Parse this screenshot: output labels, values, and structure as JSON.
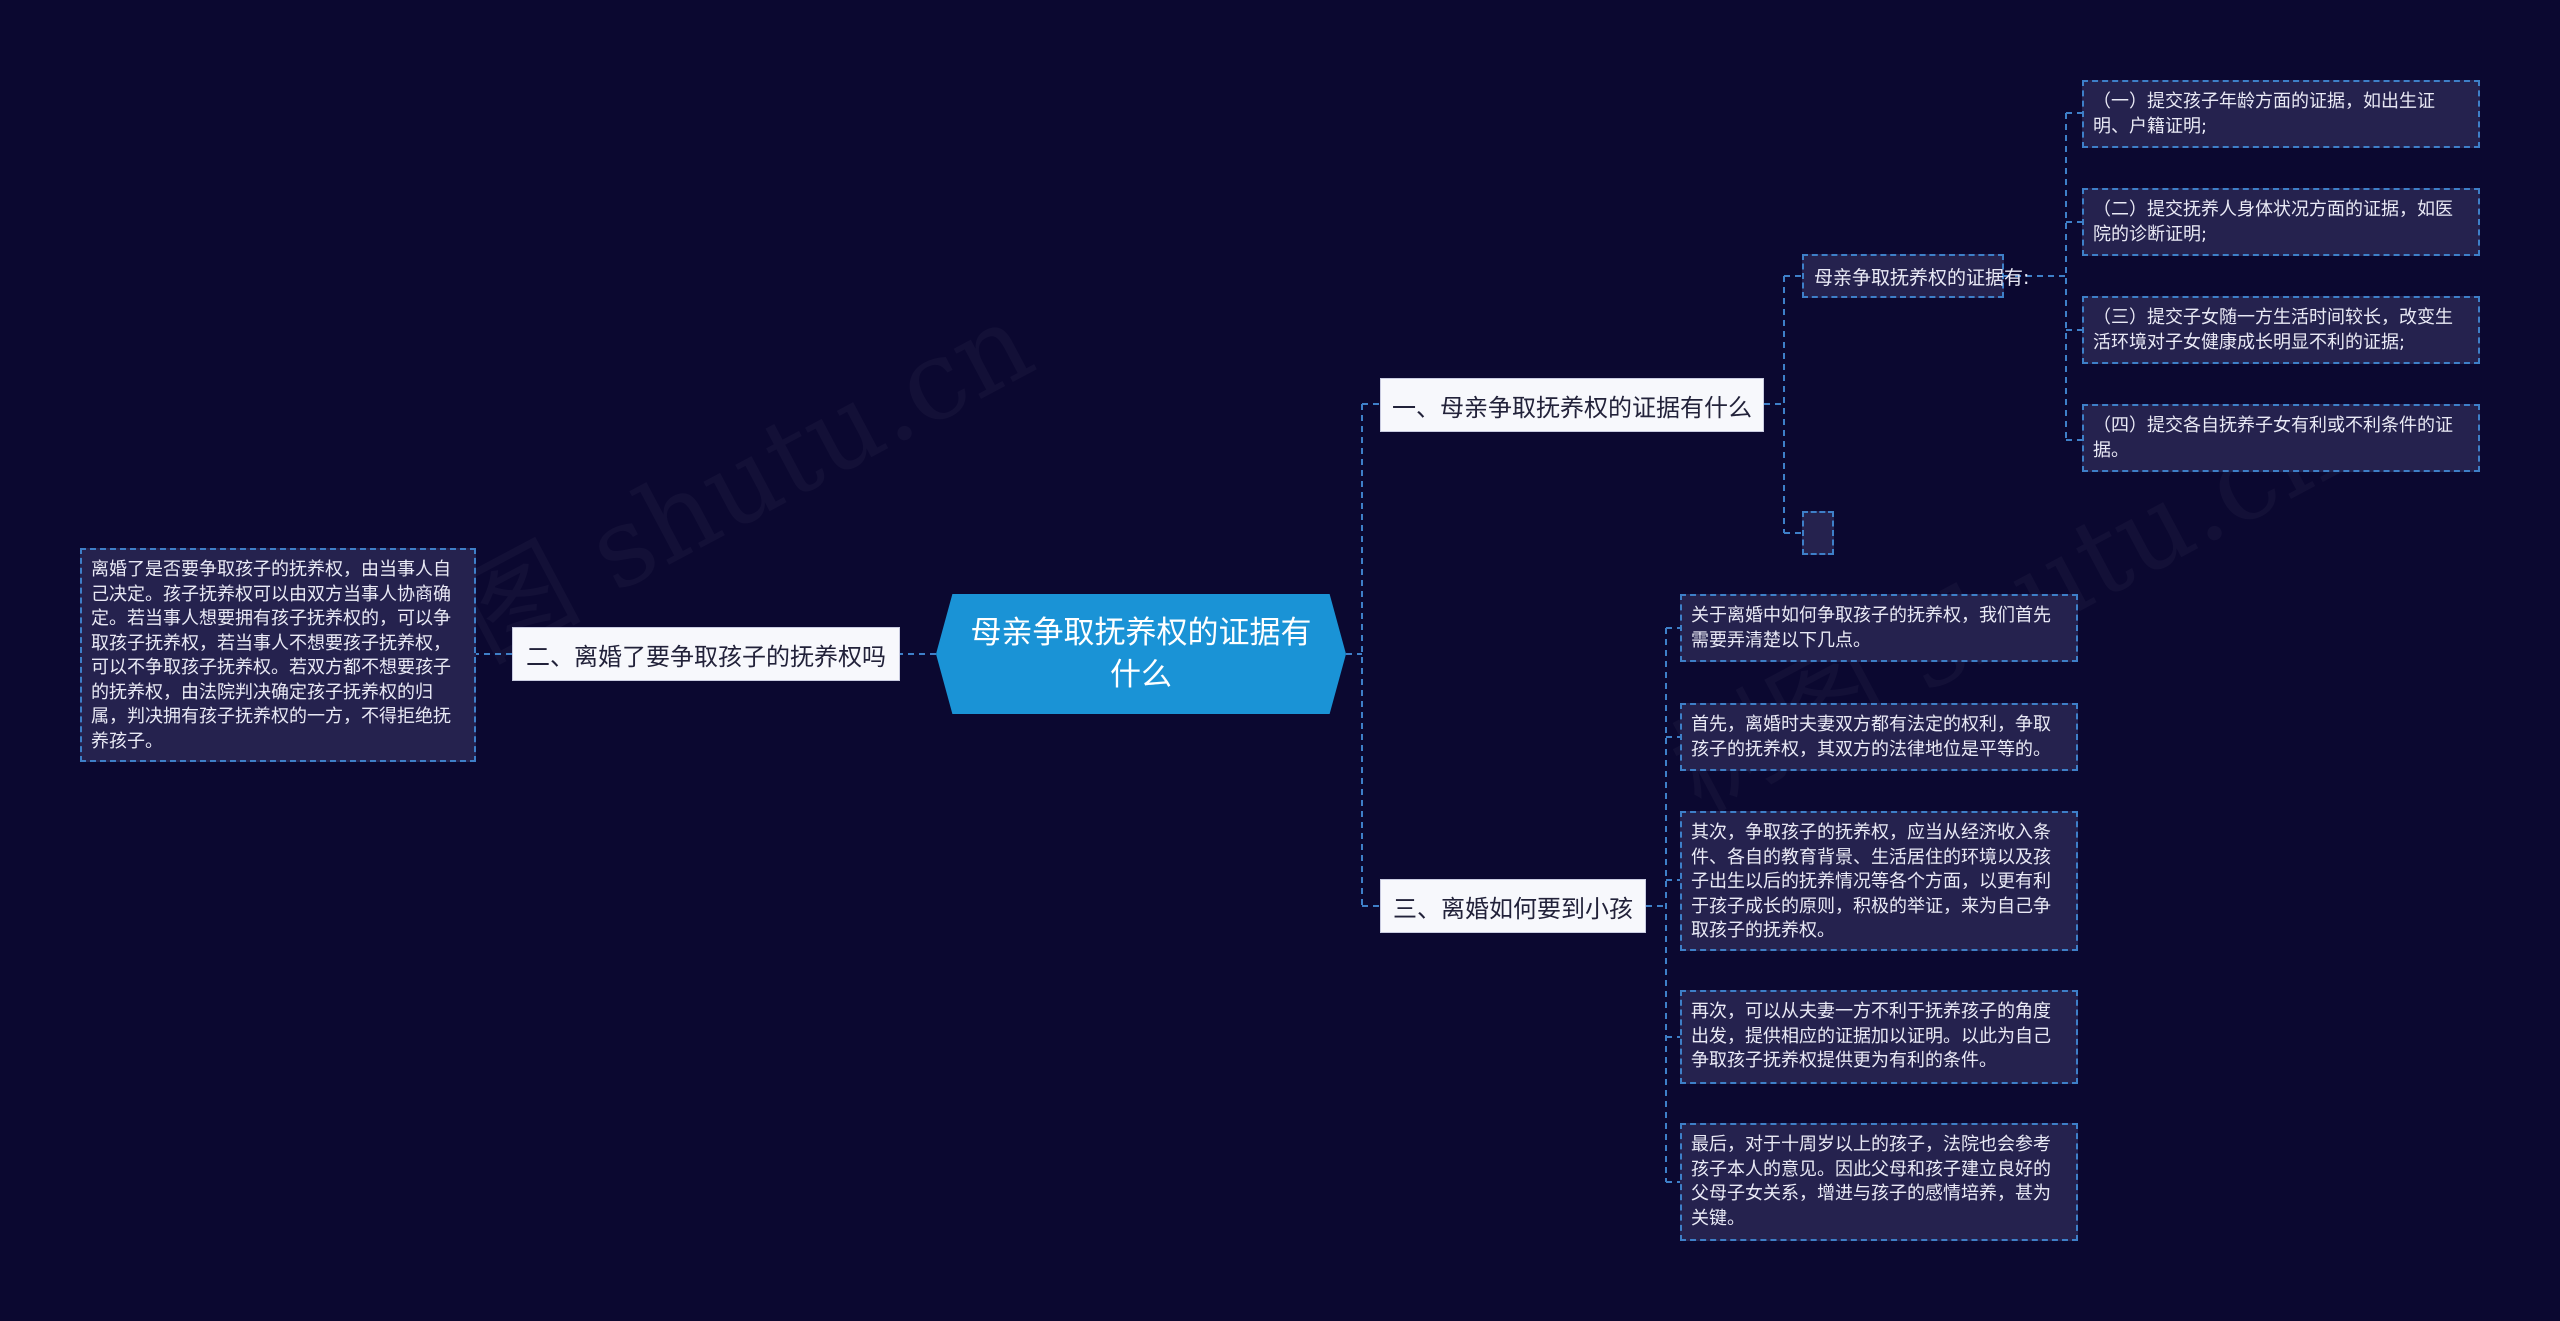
{
  "watermarks": [
    "树图 shutu.cn",
    "树图 shutu.cn"
  ],
  "root": {
    "text": "母亲争取抚养权的证据有什么"
  },
  "branches": {
    "b1": "一、母亲争取抚养权的证据有什么",
    "b2": "二、离婚了要争取孩子的抚养权吗",
    "b3": "三、离婚如何要到小孩"
  },
  "b1_label": "母亲争取抚养权的证据有:",
  "b1_items": [
    "（一）提交孩子年龄方面的证据，如出生证明、户籍证明;",
    "（二）提交抚养人身体状况方面的证据，如医院的诊断证明;",
    "（三）提交子女随一方生活时间较长，改变生活环境对子女健康成长明显不利的证据;",
    "（四）提交各自抚养子女有利或不利条件的证据。"
  ],
  "b2_detail": "离婚了是否要争取孩子的抚养权，由当事人自己决定。孩子抚养权可以由双方当事人协商确定。若当事人想要拥有孩子抚养权的，可以争取孩子抚养权，若当事人不想要孩子抚养权，可以不争取孩子抚养权。若双方都不想要孩子的抚养权，由法院判决确定孩子抚养权的归属，判决拥有孩子抚养权的一方，不得拒绝抚养孩子。",
  "b3_items": [
    "关于离婚中如何争取孩子的抚养权，我们首先需要弄清楚以下几点。",
    "首先，离婚时夫妻双方都有法定的权利，争取孩子的抚养权，其双方的法律地位是平等的。",
    "其次，争取孩子的抚养权，应当从经济收入条件、各自的教育背景、生活居住的环境以及孩子出生以后的抚养情况等各个方面，以更有利于孩子成长的原则，积极的举证，来为自己争取孩子的抚养权。",
    "再次，可以从夫妻一方不利于抚养孩子的角度出发，提供相应的证据加以证明。以此为自己争取孩子抚养权提供更为有利的条件。",
    "最后，对于十周岁以上的孩子，法院也会参考孩子本人的意见。因此父母和孩子建立良好的父母子女关系，增进与孩子的感情培养，甚为关键。"
  ],
  "colors": {
    "background": "#0b0830",
    "root": "#1a93d6",
    "connector": "#3e7fc8",
    "leaf": "#25224e",
    "branch": "#f7f8fc"
  }
}
